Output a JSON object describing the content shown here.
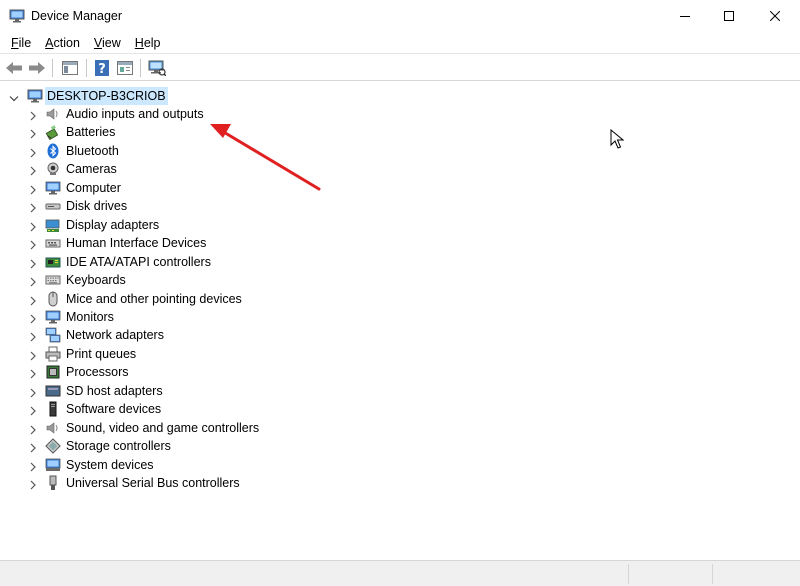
{
  "window": {
    "title": "Device Manager"
  },
  "menu": [
    {
      "label": "File",
      "mnemonic": "F",
      "rest": "ile"
    },
    {
      "label": "Action",
      "mnemonic": "A",
      "rest": "ction"
    },
    {
      "label": "View",
      "mnemonic": "V",
      "rest": "iew"
    },
    {
      "label": "Help",
      "mnemonic": "H",
      "rest": "elp"
    }
  ],
  "toolbar": {
    "buttons": [
      "back-icon",
      "forward-icon",
      "show-hide-console-tree-icon",
      "help-icon",
      "properties-icon",
      "scan-hardware-icon"
    ]
  },
  "tree": {
    "root": {
      "label": "DESKTOP-B3CRIOB",
      "icon": "computer-icon"
    },
    "categories": [
      {
        "label": "Audio inputs and outputs",
        "icon": "speaker-icon"
      },
      {
        "label": "Batteries",
        "icon": "battery-icon"
      },
      {
        "label": "Bluetooth",
        "icon": "bluetooth-icon"
      },
      {
        "label": "Cameras",
        "icon": "camera-icon"
      },
      {
        "label": "Computer",
        "icon": "monitor-icon"
      },
      {
        "label": "Disk drives",
        "icon": "disk-drive-icon"
      },
      {
        "label": "Display adapters",
        "icon": "display-adapter-icon"
      },
      {
        "label": "Human Interface Devices",
        "icon": "hid-icon"
      },
      {
        "label": "IDE ATA/ATAPI controllers",
        "icon": "ide-controller-icon"
      },
      {
        "label": "Keyboards",
        "icon": "keyboard-icon"
      },
      {
        "label": "Mice and other pointing devices",
        "icon": "mouse-icon"
      },
      {
        "label": "Monitors",
        "icon": "monitor-icon"
      },
      {
        "label": "Network adapters",
        "icon": "network-adapter-icon"
      },
      {
        "label": "Print queues",
        "icon": "printer-icon"
      },
      {
        "label": "Processors",
        "icon": "processor-icon"
      },
      {
        "label": "SD host adapters",
        "icon": "sd-card-icon"
      },
      {
        "label": "Software devices",
        "icon": "software-device-icon"
      },
      {
        "label": "Sound, video and game controllers",
        "icon": "speaker-icon"
      },
      {
        "label": "Storage controllers",
        "icon": "storage-controller-icon"
      },
      {
        "label": "System devices",
        "icon": "system-device-icon"
      },
      {
        "label": "Universal Serial Bus controllers",
        "icon": "usb-icon"
      }
    ]
  },
  "colors": {
    "selection": "#cce8ff",
    "annotation_arrow": "#e02020"
  }
}
